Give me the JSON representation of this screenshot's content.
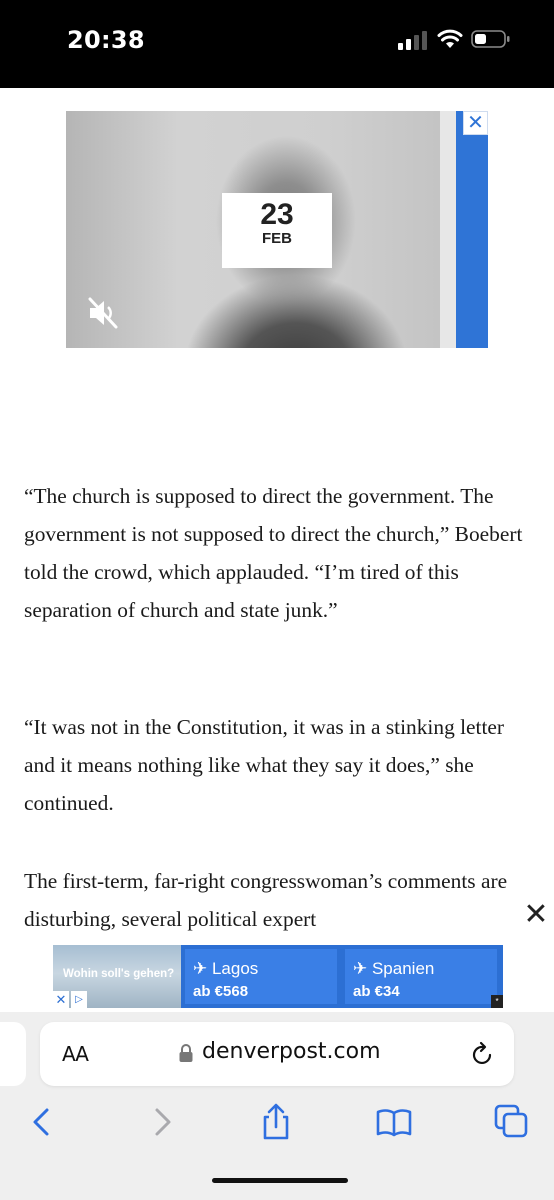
{
  "status_bar": {
    "time": "20:38",
    "icons": [
      "signal-icon",
      "wifi-icon",
      "battery-icon"
    ]
  },
  "top_ad": {
    "date_day": "23",
    "date_month": "FEB",
    "close_icon": "close-icon",
    "mute_icon": "speaker-muted-icon",
    "colors": {
      "accent": "#2f74d6"
    }
  },
  "article": {
    "paragraphs": [
      "“The church is supposed to direct the government. The government is not supposed to direct the church,” Boebert told the crowd, which applauded. “I’m tired of this separation of church and state junk.”",
      "“It was not in the Constitution, it was in a stinking letter and it means nothing like what they say it does,” she continued.",
      "The first-term, far-right congresswoman’s comments are disturbing, several political expert"
    ]
  },
  "banner_ad": {
    "tagline": "Wohin soll's gehen?",
    "offers": [
      {
        "destination": "✈ Lagos",
        "price": "ab €568"
      },
      {
        "destination": "✈ Spanien",
        "price": "ab €34"
      }
    ],
    "close_label": "✕",
    "ad_x": "✕",
    "ad_play": "▷",
    "ad_star": "*",
    "colors": {
      "background": "#2c6fd3",
      "tile": "#3a7fe6"
    }
  },
  "browser": {
    "aa_label": "AA",
    "url": "denverpost.com",
    "nav_icons": [
      "back-icon",
      "forward-icon",
      "share-icon",
      "bookmarks-icon",
      "tabs-icon"
    ]
  }
}
